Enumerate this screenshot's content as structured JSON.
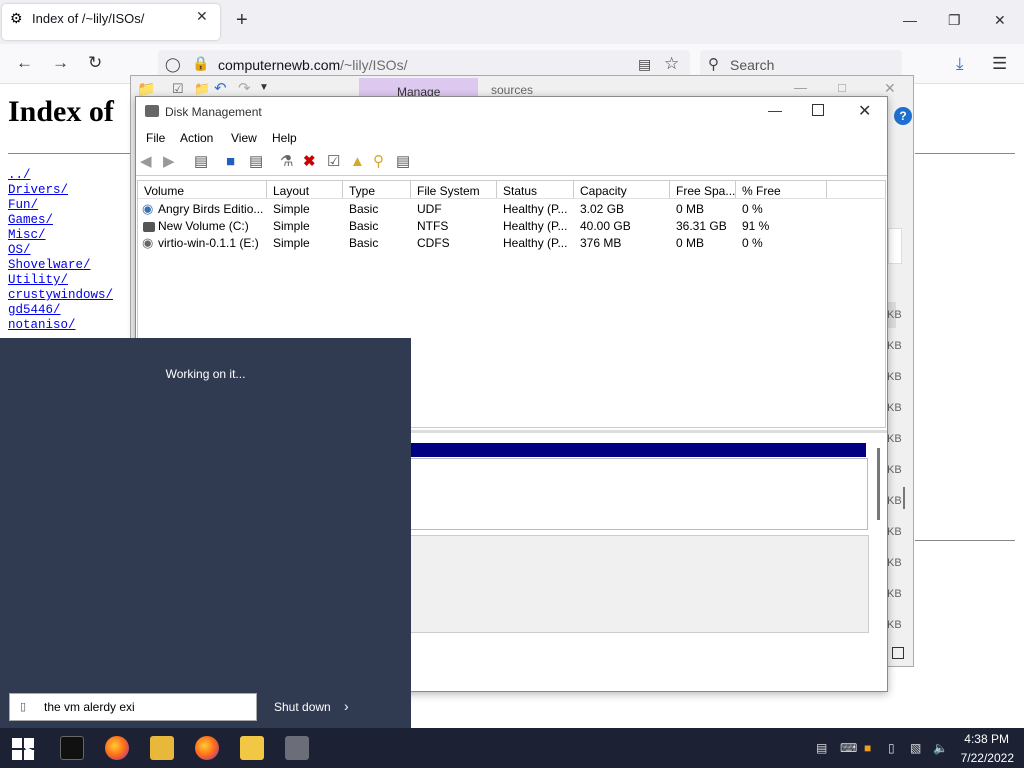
{
  "browser": {
    "tab_title": "Index of /~lily/ISOs/",
    "url_host": "computernewb.com",
    "url_path": "/~lily/ISOs/",
    "search_placeholder": "Search"
  },
  "page": {
    "heading": "Index of",
    "links": [
      "../",
      "Drivers/",
      "Fun/",
      "Games/",
      "Misc/",
      "OS/",
      "Shovelware/",
      "Utility/",
      "crustywindows/",
      "gd5446/",
      "notaniso/"
    ]
  },
  "explorer": {
    "manage_tab": "Manage",
    "breadcrumb": "sources",
    "kb_labels": [
      "KB",
      "KB",
      "KB",
      "KB",
      "KB",
      "KB",
      "KB",
      "KB",
      "KB",
      "KB",
      "KB"
    ]
  },
  "disk_management": {
    "title": "Disk Management",
    "menu": [
      "File",
      "Action",
      "View",
      "Help"
    ],
    "columns": [
      "Volume",
      "Layout",
      "Type",
      "File System",
      "Status",
      "Capacity",
      "Free Spa...",
      "% Free"
    ],
    "rows": [
      [
        "Angry Birds Editio...",
        "Simple",
        "Basic",
        "UDF",
        "Healthy (P...",
        "3.02 GB",
        "0 MB",
        "0 %"
      ],
      [
        "New Volume (C:)",
        "Simple",
        "Basic",
        "NTFS",
        "Healthy (P...",
        "40.00 GB",
        "36.31 GB",
        "91 %"
      ],
      [
        "virtio-win-0.1.1 (E:)",
        "Simple",
        "Basic",
        "CDFS",
        "Healthy (P...",
        "376 MB",
        "0 MB",
        "0 %"
      ]
    ]
  },
  "start_menu": {
    "status": "Working on it...",
    "input_value": "the vm alerdy exi",
    "shutdown_label": "Shut down"
  },
  "taskbar": {
    "time": "4:38 PM",
    "date": "7/22/2022"
  },
  "colors": {
    "start_menu_bg": "#303a50",
    "taskbar_bg": "#1c2133",
    "disk_bar": "#000080",
    "manage_tab": "#ddc8ef"
  }
}
